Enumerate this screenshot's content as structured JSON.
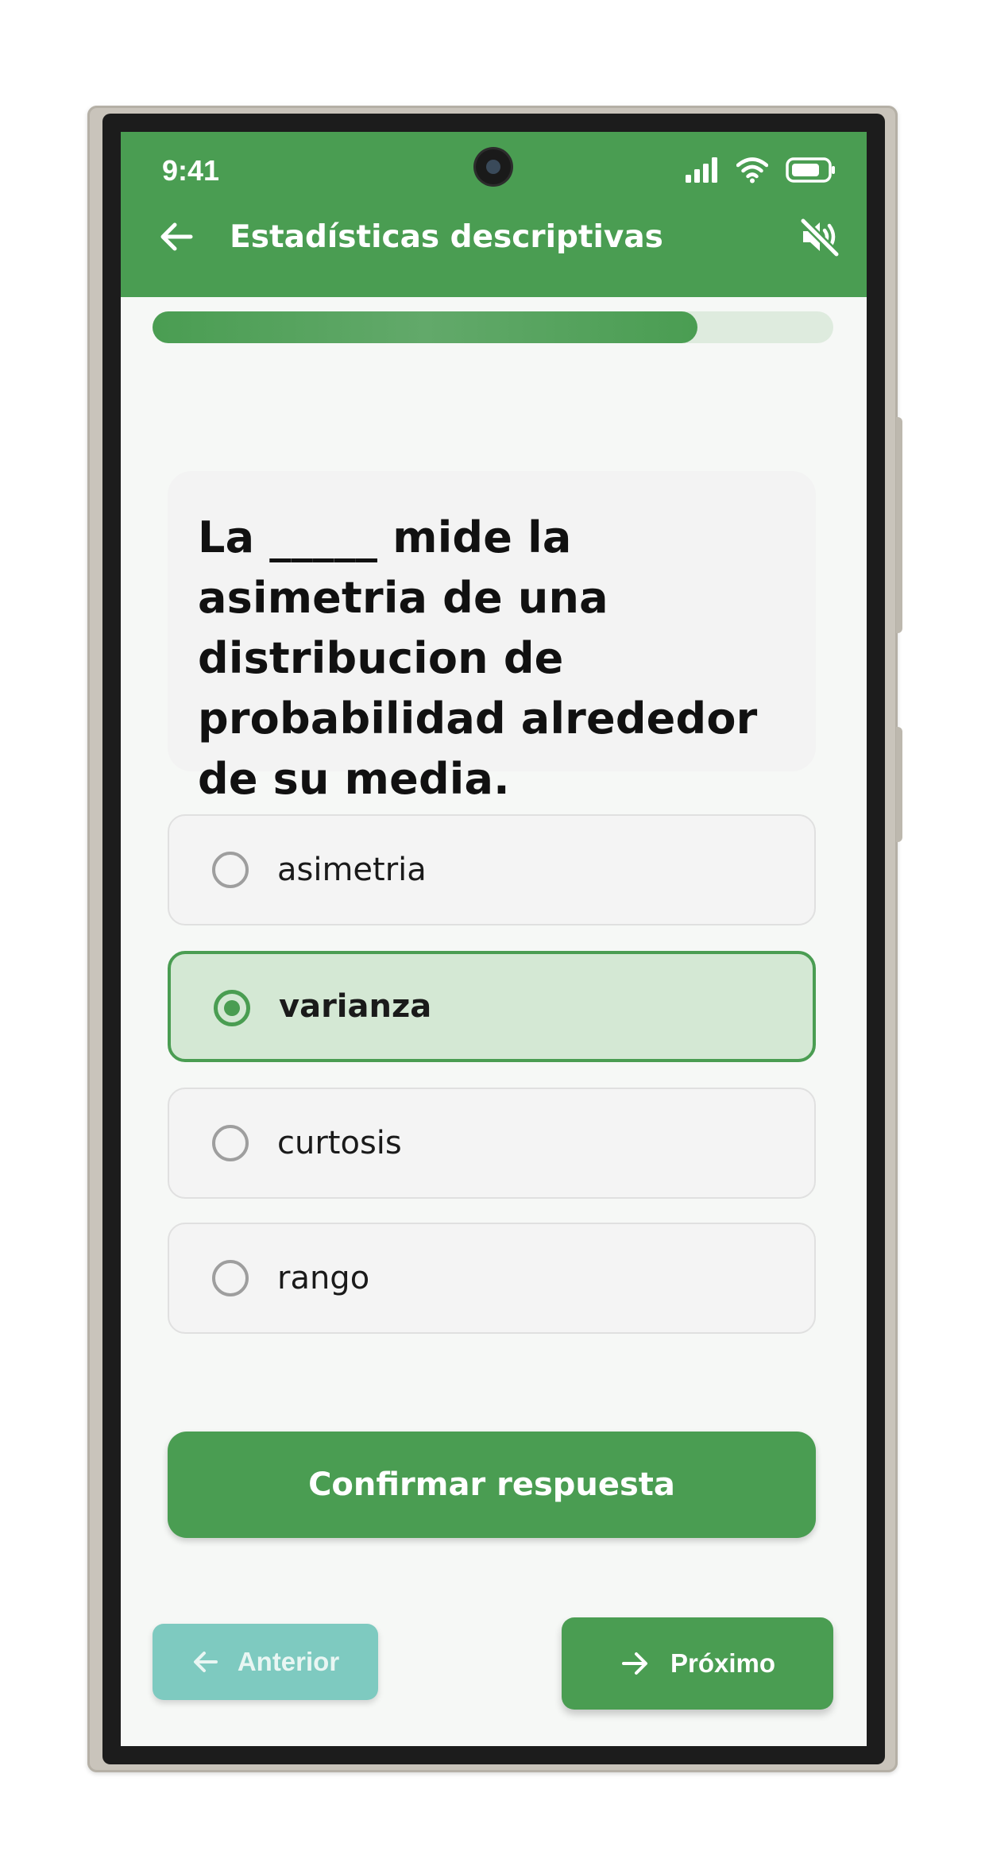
{
  "status_bar": {
    "time": "9:41"
  },
  "header": {
    "title": "Estadísticas descriptivas",
    "back_icon": "arrow-left-icon",
    "mute_icon": "volume-mute-icon"
  },
  "progress": {
    "fraction": 0.8
  },
  "question": {
    "text": "La _____ mide la asimetria de una distribucion de probabilidad alrededor de su media."
  },
  "options": [
    {
      "label": "asimetria",
      "selected": false
    },
    {
      "label": "varianza",
      "selected": true
    },
    {
      "label": "curtosis",
      "selected": false
    },
    {
      "label": "rango",
      "selected": false
    }
  ],
  "actions": {
    "confirm_label": "Confirmar respuesta",
    "prev_label": "Anterior",
    "next_label": "Próximo"
  },
  "colors": {
    "primary": "#4a9d52",
    "selected_bg": "#d4e8d4",
    "prev_button": "#7ecac0",
    "progress_track": "#deebde"
  }
}
